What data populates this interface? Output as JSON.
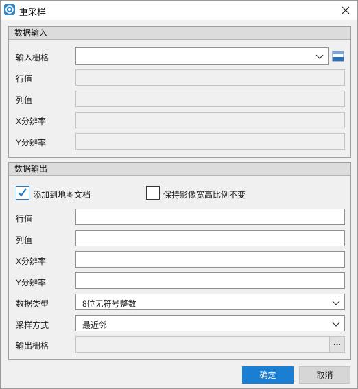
{
  "window": {
    "title": "重采样",
    "close_icon": "close-icon",
    "app_icon": "resample-app-icon"
  },
  "input_group": {
    "header": "数据输入",
    "raster_label": "输入栅格",
    "raster_value": "",
    "rows_label": "行值",
    "rows_value": "",
    "cols_label": "列值",
    "cols_value": "",
    "xres_label": "X分辨率",
    "xres_value": "",
    "yres_label": "Y分辨率",
    "yres_value": ""
  },
  "output_group": {
    "header": "数据输出",
    "add_to_map_label": "添加到地图文档",
    "add_to_map_checked": true,
    "keep_aspect_label": "保持影像宽高比例不变",
    "keep_aspect_checked": false,
    "rows_label": "行值",
    "rows_value": "",
    "cols_label": "列值",
    "cols_value": "",
    "xres_label": "X分辨率",
    "xres_value": "",
    "yres_label": "Y分辨率",
    "yres_value": "",
    "datatype_label": "数据类型",
    "datatype_value": "8位无符号整数",
    "method_label": "采样方式",
    "method_value": "最近邻",
    "output_label": "输出栅格",
    "output_value": "",
    "browse_label": "..."
  },
  "buttons": {
    "ok": "确定",
    "cancel": "取消"
  },
  "colors": {
    "primary": "#1a7fd3",
    "check": "#1a7fd3"
  }
}
